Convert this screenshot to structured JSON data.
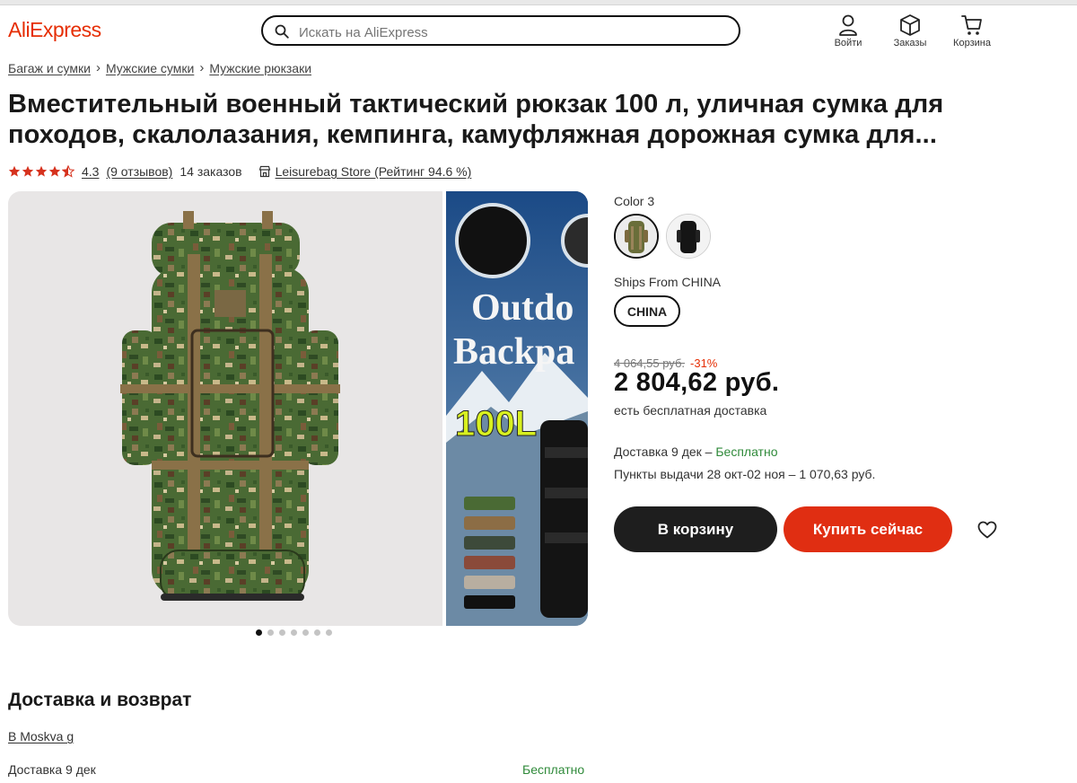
{
  "header": {
    "logo": "AliExpress",
    "search_placeholder": "Искать на AliExpress",
    "login_label": "Войти",
    "orders_label": "Заказы",
    "cart_label": "Корзина"
  },
  "breadcrumbs": [
    "Багаж и сумки",
    "Мужские сумки",
    "Мужские рюкзаки"
  ],
  "product": {
    "title": "Вместительный военный тактический рюкзак 100 л, уличная сумка для походов, скалолазания, кемпинга, камуфляжная дорожная сумка для...",
    "rating": "4.3",
    "rating_stars": 4.5,
    "reviews": "(9 отзывов)",
    "orders": "14 заказов",
    "store": "Leisurebag Store (Рейтинг 94.6 %)"
  },
  "gallery": {
    "side_text_1": "Outdo",
    "side_text_2": "Backpa",
    "side_text_3": "100L",
    "slide_count": 7,
    "active_slide": 1
  },
  "options": {
    "color_label": "Color 3",
    "ships_label": "Ships From CHINA",
    "ships_value": "CHINA"
  },
  "pricing": {
    "old_price": "4 064,55 руб.",
    "discount": "-31%",
    "price": "2 804,62 руб.",
    "free_shipping": "есть бесплатная доставка",
    "delivery_prefix": "Доставка 9 дек – ",
    "delivery_free": "Бесплатно",
    "pickup": "Пункты выдачи 28 окт-02 ноя – 1 070,63 руб."
  },
  "actions": {
    "add_to_cart": "В корзину",
    "buy_now": "Купить сейчас"
  },
  "delivery_section": {
    "title": "Доставка и возврат",
    "location": "В Moskva g",
    "row_label": "Доставка 9 дек",
    "row_value": "Бесплатно"
  },
  "colors": {
    "accent": "#e62e04",
    "buy_button": "#e02e12",
    "cart_button": "#1e1e1e",
    "free_green": "#2f8a3a"
  }
}
